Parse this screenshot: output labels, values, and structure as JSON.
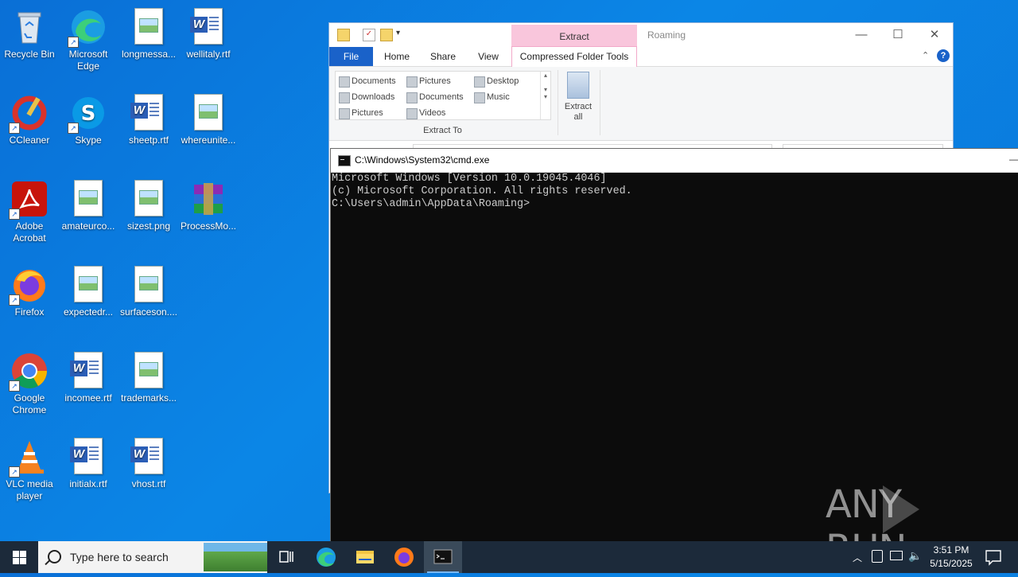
{
  "desktop": {
    "icons": [
      {
        "label": "Recycle Bin"
      },
      {
        "label": "Microsoft Edge"
      },
      {
        "label": "longmessa..."
      },
      {
        "label": "wellitaly.rtf"
      },
      {
        "label": "CCleaner"
      },
      {
        "label": "Skype"
      },
      {
        "label": "sheetp.rtf"
      },
      {
        "label": "whereunite..."
      },
      {
        "label": "Adobe Acrobat"
      },
      {
        "label": "amateurco..."
      },
      {
        "label": "sizest.png"
      },
      {
        "label": "ProcessMo..."
      },
      {
        "label": "Firefox"
      },
      {
        "label": "expectedr..."
      },
      {
        "label": "surfaceson...."
      },
      {
        "label": "Google Chrome"
      },
      {
        "label": "incomee.rtf"
      },
      {
        "label": "trademarks..."
      },
      {
        "label": "VLC media player"
      },
      {
        "label": "initialx.rtf"
      },
      {
        "label": "vhost.rtf"
      }
    ]
  },
  "explorer": {
    "title": "Roaming",
    "context_header": "Extract",
    "tabs": [
      "File",
      "Home",
      "Share",
      "View",
      "Compressed Folder Tools"
    ],
    "gallery": [
      "Documents",
      "Pictures",
      "Desktop",
      "Downloads",
      "Documents",
      "Music",
      "Pictures",
      "Videos"
    ],
    "group_label": "Extract To",
    "extract_all": "Extract all"
  },
  "cmd": {
    "title": "C:\\Windows\\System32\\cmd.exe",
    "lines": [
      "Microsoft Windows [Version 10.0.19045.4046]",
      "(c) Microsoft Corporation. All rights reserved.",
      "",
      "C:\\Users\\admin\\AppData\\Roaming>"
    ]
  },
  "watermark": "ANY RUN",
  "taskbar": {
    "search_placeholder": "Type here to search",
    "time": "3:51 PM",
    "date": "5/15/2025"
  }
}
